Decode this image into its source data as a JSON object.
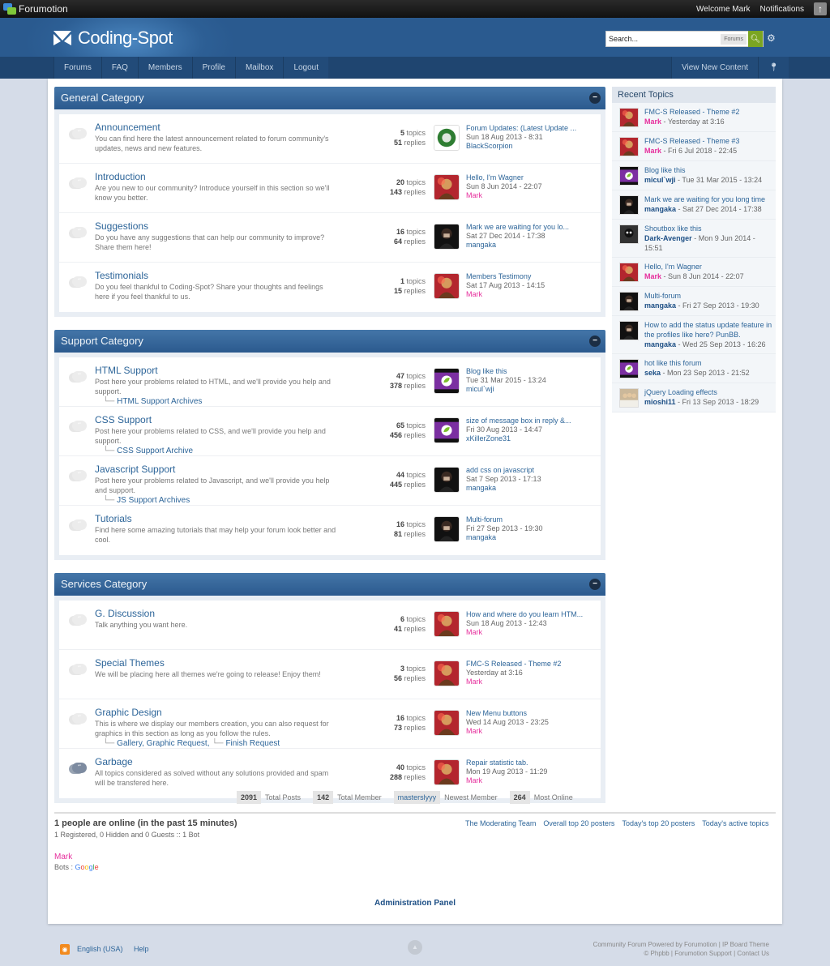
{
  "topbar": {
    "brand": "Forumotion",
    "welcome": "Welcome Mark",
    "notifications": "Notifications"
  },
  "header": {
    "site_name": "Coding-Spot",
    "search_placeholder": "Search...",
    "search_scope": "Forums"
  },
  "nav": {
    "items": [
      "Forums",
      "FAQ",
      "Members",
      "Profile",
      "Mailbox",
      "Logout"
    ],
    "view_new": "View New Content"
  },
  "categories": [
    {
      "title": "General Category",
      "forums": [
        {
          "title": "Announcement",
          "desc": "You can find here the latest announcement related to forum community's updates, news and new features.",
          "topics": "5",
          "replies": "51",
          "last_title": "Forum Updates: (Latest Update ...",
          "last_date": "Sun 18 Aug 2013 - 8:31",
          "last_user": "BlackScorpion",
          "user_color": "blue",
          "avatar": "green-emblem"
        },
        {
          "title": "Introduction",
          "desc": "Are you new to our community? Introduce yourself in this section so we'll know you better.",
          "topics": "20",
          "replies": "143",
          "last_title": "Hello, I'm Wagner",
          "last_date": "Sun 8 Jun 2014 - 22:07",
          "last_user": "Mark",
          "user_color": "pink",
          "avatar": "red-character"
        },
        {
          "title": "Suggestions",
          "desc": "Do you have any suggestions that can help our community to improve? Share them here!",
          "topics": "16",
          "replies": "64",
          "last_title": "Mark we are waiting for you lo...",
          "last_date": "Sat 27 Dec 2014 - 17:38",
          "last_user": "mangaka",
          "user_color": "blue",
          "avatar": "dark-character"
        },
        {
          "title": "Testimonials",
          "desc": "Do you feel thankful to Coding-Spot? Share your thoughts and feelings here if you feel thankful to us.",
          "topics": "1",
          "replies": "15",
          "last_title": "Members Testimony",
          "last_date": "Sat 17 Aug 2013 - 14:15",
          "last_user": "Mark",
          "user_color": "pink",
          "avatar": "red-character"
        }
      ]
    },
    {
      "title": "Support Category",
      "forums": [
        {
          "title": "HTML Support",
          "desc": "Post here your problems related to HTML, and we'll provide you help and support.",
          "subforums": [
            "HTML Support Archives"
          ],
          "topics": "47",
          "replies": "378",
          "last_title": "Blog like this",
          "last_date": "Tue 31 Mar 2015 - 13:24",
          "last_user": "micul`wji",
          "user_color": "blue",
          "avatar": "purple-leaf"
        },
        {
          "title": "CSS Support",
          "desc": "Post here your problems related to CSS, and we'll provide you help and support.",
          "subforums": [
            "CSS Support Archive"
          ],
          "topics": "65",
          "replies": "456",
          "last_title": "size of message box in reply &...",
          "last_date": "Fri 30 Aug 2013 - 14:47",
          "last_user": "xKillerZone31",
          "user_color": "blue",
          "avatar": "purple-leaf"
        },
        {
          "title": "Javascript Support",
          "desc": "Post here your problems related to Javascript, and we'll provide you help and support.",
          "subforums": [
            "JS Support Archives"
          ],
          "topics": "44",
          "replies": "445",
          "last_title": "add css on javascript",
          "last_date": "Sat 7 Sep 2013 - 17:13",
          "last_user": "mangaka",
          "user_color": "blue",
          "avatar": "dark-character"
        },
        {
          "title": "Tutorials",
          "desc": "Find here some amazing tutorials that may help your forum look better and cool.",
          "topics": "16",
          "replies": "81",
          "last_title": "Multi-forum",
          "last_date": "Fri 27 Sep 2013 - 19:30",
          "last_user": "mangaka",
          "user_color": "blue",
          "avatar": "dark-character"
        }
      ]
    },
    {
      "title": "Services Category",
      "forums": [
        {
          "title": "G. Discussion",
          "desc": "Talk anything you want here.",
          "topics": "6",
          "replies": "41",
          "last_title": "How and where do you learn HTM...",
          "last_date": "Sun 18 Aug 2013 - 12:43",
          "last_user": "Mark",
          "user_color": "pink",
          "avatar": "red-character"
        },
        {
          "title": "Special Themes",
          "desc": "We will be placing here all themes we're going to release! Enjoy them!",
          "topics": "3",
          "replies": "56",
          "last_title": "FMC-S Released - Theme #2",
          "last_date": "Yesterday at 3:16",
          "last_user": "Mark",
          "user_color": "pink",
          "avatar": "red-character"
        },
        {
          "title": "Graphic Design",
          "desc": "This is where we display our members creation, you can also request for graphics in this section as long as you follow the rules.",
          "subforums": [
            "Gallery",
            "Graphic Request",
            "Finish Request"
          ],
          "topics": "16",
          "replies": "73",
          "last_title": "New Menu buttons",
          "last_date": "Wed 14 Aug 2013 - 23:25",
          "last_user": "Mark",
          "user_color": "pink",
          "avatar": "red-character"
        },
        {
          "title": "Garbage",
          "desc": "All topics considered as solved without any solutions provided and spam will be transfered here.",
          "topics": "40",
          "replies": "288",
          "last_title": "Repair statistic tab.",
          "last_date": "Mon 19 Aug 2013 - 11:29",
          "last_user": "Mark",
          "user_color": "pink",
          "avatar": "red-character",
          "icon": "locked"
        }
      ]
    }
  ],
  "labels": {
    "topics": "topics",
    "replies": "replies"
  },
  "recent": {
    "title": "Recent Topics",
    "items": [
      {
        "title": "FMC-S Released - Theme #2",
        "user": "Mark",
        "date": "- Yesterday at 3:16",
        "user_color": "pink",
        "avatar": "red-character"
      },
      {
        "title": "FMC-S Released - Theme #3",
        "user": "Mark",
        "date": "- Fri 6 Jul 2018 - 22:45",
        "user_color": "pink",
        "avatar": "red-character"
      },
      {
        "title": "Blog like this",
        "user": "micul`wji",
        "date": "- Tue 31 Mar 2015 - 13:24",
        "user_color": "blue",
        "avatar": "purple-leaf"
      },
      {
        "title": "Mark we are waiting for you long time",
        "user": "mangaka",
        "date": "- Sat 27 Dec 2014 - 17:38",
        "user_color": "blue",
        "avatar": "dark-character"
      },
      {
        "title": "Shoutbox like this",
        "user": "Dark-Avenger",
        "date": "- Mon 9 Jun 2014 - 15:51",
        "user_color": "blue",
        "avatar": "dark-robot"
      },
      {
        "title": "Hello, I'm Wagner",
        "user": "Mark",
        "date": "- Sun 8 Jun 2014 - 22:07",
        "user_color": "pink",
        "avatar": "red-character"
      },
      {
        "title": "Multi-forum",
        "user": "mangaka",
        "date": "- Fri 27 Sep 2013 - 19:30",
        "user_color": "blue",
        "avatar": "dark-character"
      },
      {
        "title": "How to add the status update feature in the profiles like here? PunBB.",
        "user": "mangaka",
        "date": "- Wed 25 Sep 2013 - 16:26",
        "user_color": "blue",
        "avatar": "dark-character"
      },
      {
        "title": "hot like this forum",
        "user": "seka",
        "date": "- Mon 23 Sep 2013 - 21:52",
        "user_color": "blue",
        "avatar": "purple-leaf"
      },
      {
        "title": "jQuery Loading effects",
        "user": "mioshi11",
        "date": "- Fri 13 Sep 2013 - 18:29",
        "user_color": "blue",
        "avatar": "group-photo"
      }
    ]
  },
  "stats": {
    "total_posts": "2091",
    "total_posts_label": "Total Posts",
    "total_members": "142",
    "total_members_label": "Total Member",
    "newest_member": "masterslyyy",
    "newest_member_label": "Newest Member",
    "most_online": "264",
    "most_online_label": "Most Online"
  },
  "online": {
    "heading": "1 people are online (in the past 15 minutes)",
    "summary": "1 Registered, 0 Hidden and 0 Guests :: 1 Bot",
    "user": "Mark",
    "bots_label": "Bots : ",
    "bot": "Google"
  },
  "links": [
    "The Moderating Team",
    "Overall top 20 posters",
    "Today's top 20 posters",
    "Today's active topics"
  ],
  "admin_panel": "Administration Panel",
  "footer": {
    "language": "English (USA)",
    "help": "Help",
    "copyright_line1": "Community Forum Powered by Forumotion | IP Board Theme",
    "copyright_line2": "© Phpbb | Forumotion Support | Contact Us"
  },
  "colors": {
    "accent": "#2b5a8e",
    "pink_user": "#e62e9c",
    "search_button": "#7ba521"
  }
}
